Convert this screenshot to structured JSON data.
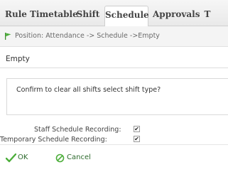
{
  "tabs": [
    {
      "label": "Rule"
    },
    {
      "label": "Timetable"
    },
    {
      "label": "Shift"
    },
    {
      "label": "Schedule",
      "active": true
    },
    {
      "label": "Approvals"
    },
    {
      "label": "T"
    }
  ],
  "position": {
    "text": "Position: Attendance -> Schedule ->Empty",
    "icon": "flag-icon"
  },
  "section": {
    "title": "Empty"
  },
  "message": {
    "text": "Confirm to clear all shifts select shift type?"
  },
  "options": [
    {
      "label": "Staff Schedule Recording:",
      "checked": true,
      "mark": "✔"
    },
    {
      "label": "Temporary Schedule Recording:",
      "checked": true,
      "mark": "✔"
    }
  ],
  "actions": {
    "ok": {
      "label": "OK",
      "icon": "check-icon"
    },
    "cancel": {
      "label": "Cancel",
      "icon": "cancel-icon"
    }
  },
  "colors": {
    "accent_green": "#2d6a2d",
    "tab_bar": "#eeeeee"
  }
}
